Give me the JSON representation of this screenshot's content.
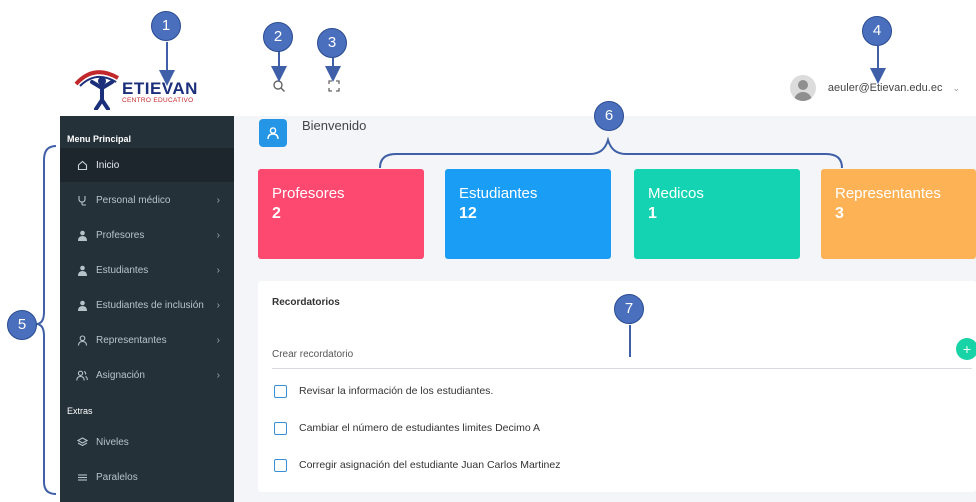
{
  "logo": {
    "name": "ETIEVAN",
    "subtitle": "CENTRO EDUCATIVO"
  },
  "header": {
    "user_email": "aeuler@Etievan.edu.ec",
    "search_icon": "search-icon",
    "fullscreen_icon": "fullscreen-icon"
  },
  "sidebar": {
    "section_main": "Menu Principal",
    "section_extras": "Extras",
    "items": [
      {
        "label": "Inicio",
        "icon": "home-icon",
        "has_submenu": false,
        "active": true
      },
      {
        "label": "Personal médico",
        "icon": "stethoscope-icon",
        "has_submenu": true
      },
      {
        "label": "Profesores",
        "icon": "teacher-icon",
        "has_submenu": true
      },
      {
        "label": "Estudiantes",
        "icon": "student-icon",
        "has_submenu": true
      },
      {
        "label": "Estudiantes de inclusión",
        "icon": "student-icon",
        "has_submenu": true
      },
      {
        "label": "Representantes",
        "icon": "user-icon",
        "has_submenu": true
      },
      {
        "label": "Asignación",
        "icon": "users-icon",
        "has_submenu": true
      }
    ],
    "extras": [
      {
        "label": "Niveles",
        "icon": "layers-icon"
      },
      {
        "label": "Paralelos",
        "icon": "menu-icon"
      }
    ]
  },
  "main": {
    "welcome": "Bienvenido",
    "stats": [
      {
        "label": "Profesores",
        "value": "2",
        "color": "#fd4870"
      },
      {
        "label": "Estudiantes",
        "value": "12",
        "color": "#1a9ef5"
      },
      {
        "label": "Medicos",
        "value": "1",
        "color": "#14d3b3"
      },
      {
        "label": "Representantes",
        "value": "3",
        "color": "#fdb256"
      }
    ],
    "reminders": {
      "title": "Recordatorios",
      "create_label": "Crear recordatorio",
      "add_label": "+",
      "items": [
        "Revisar la información de los estudiantes.",
        "Cambiar el número de estudiantes limites Decimo A",
        "Corregir asignación del estudiante Juan Carlos Martinez"
      ]
    }
  },
  "annotations": [
    "1",
    "2",
    "3",
    "4",
    "5",
    "6",
    "7"
  ],
  "colors": {
    "sidebar": "#243139",
    "accent": "#2596e6",
    "annotation": "#4a6fbd"
  }
}
